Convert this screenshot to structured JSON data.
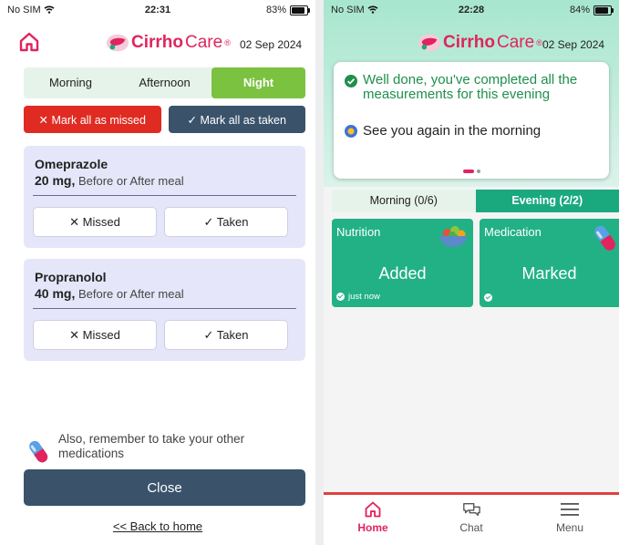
{
  "left": {
    "status": {
      "carrier": "No SIM",
      "time": "22:31",
      "battery": "83%"
    },
    "brand": {
      "cirrho": "Cirrho",
      "care": "Care",
      "reg": "®"
    },
    "date": "02 Sep 2024",
    "tabs": [
      {
        "label": "Morning",
        "active": false
      },
      {
        "label": "Afternoon",
        "active": false
      },
      {
        "label": "Night",
        "active": true
      }
    ],
    "mark_all_missed": "✕ Mark all as missed",
    "mark_all_taken": "✓ Mark all as taken",
    "medications": [
      {
        "name": "Omeprazole",
        "dose": "20 mg,",
        "timing": " Before or After meal",
        "missed_label": "✕ Missed",
        "taken_label": "✓ Taken"
      },
      {
        "name": "Propranolol",
        "dose": "40 mg,",
        "timing": " Before or After meal",
        "missed_label": "✕ Missed",
        "taken_label": "✓ Taken"
      }
    ],
    "remember_text": "Also, remember to take your other medications",
    "close_label": "Close",
    "back_link": "<< Back to home"
  },
  "right": {
    "status": {
      "carrier": "No SIM",
      "time": "22:28",
      "battery": "84%"
    },
    "brand": {
      "cirrho": "Cirrho",
      "care": "Care",
      "reg": "®"
    },
    "date": "02 Sep 2024",
    "message_done": "Well done, you've completed all the measurements for this evening",
    "message_again": "See you again in the morning",
    "tabs": [
      {
        "label": "Morning (0/6)",
        "active": false
      },
      {
        "label": "Evening (2/2)",
        "active": true
      }
    ],
    "tiles": [
      {
        "title": "Nutrition",
        "value": "Added",
        "footer": "just now"
      },
      {
        "title": "Medication",
        "value": "Marked",
        "footer": ""
      }
    ],
    "nav": [
      {
        "label": "Home",
        "icon": "home-icon",
        "active": true
      },
      {
        "label": "Chat",
        "icon": "chat-icon",
        "active": false
      },
      {
        "label": "Menu",
        "icon": "menu-icon",
        "active": false
      }
    ]
  },
  "colors": {
    "brand_pink": "#e0245e",
    "night_tab_green": "#7cc241",
    "missed_red": "#df2b22",
    "navy": "#3a536b",
    "teal": "#1aa97f",
    "card_lavender": "#e6e6fa"
  }
}
